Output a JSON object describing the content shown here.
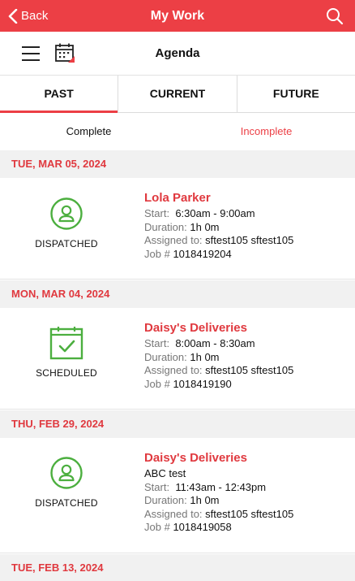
{
  "header": {
    "back_label": "Back",
    "title": "My Work"
  },
  "subheader": {
    "title": "Agenda"
  },
  "tabs": [
    {
      "label": "PAST",
      "active": true
    },
    {
      "label": "CURRENT",
      "active": false
    },
    {
      "label": "FUTURE",
      "active": false
    }
  ],
  "filter": {
    "complete": "Complete",
    "incomplete": "Incomplete"
  },
  "groups": [
    {
      "date": "TUE, MAR 05, 2024",
      "job": {
        "status": "DISPATCHED",
        "status_icon": "person-circle-icon",
        "name": "Lola Parker",
        "start_label": "Start:",
        "start": "6:30am - 9:00am",
        "duration_label": "Duration:",
        "duration": "1h 0m",
        "assigned_label": "Assigned to:",
        "assigned": "sftest105 sftest105",
        "job_label": "Job #",
        "job_number": "1018419204"
      }
    },
    {
      "date": "MON, MAR 04, 2024",
      "job": {
        "status": "SCHEDULED",
        "status_icon": "calendar-check-icon",
        "name": "Daisy's Deliveries",
        "start_label": "Start:",
        "start": "8:00am - 8:30am",
        "duration_label": "Duration:",
        "duration": "1h 0m",
        "assigned_label": "Assigned to:",
        "assigned": "sftest105 sftest105",
        "job_label": "Job #",
        "job_number": "1018419190"
      }
    },
    {
      "date": "THU, FEB 29, 2024",
      "job": {
        "status": "DISPATCHED",
        "status_icon": "person-circle-icon",
        "name": "Daisy's Deliveries",
        "description": "ABC test",
        "start_label": "Start:",
        "start": "11:43am - 12:43pm",
        "duration_label": "Duration:",
        "duration": "1h 0m",
        "assigned_label": "Assigned to:",
        "assigned": "sftest105 sftest105",
        "job_label": "Job #",
        "job_number": "1018419058"
      }
    },
    {
      "date": "TUE, FEB 13, 2024"
    }
  ],
  "colors": {
    "brand": "#ec3f45",
    "status_green": "#4caf3f"
  },
  "icons": {
    "back": "chevron-left-icon",
    "search": "search-icon",
    "menu": "hamburger-menu-icon",
    "calendar": "calendar-icon"
  }
}
